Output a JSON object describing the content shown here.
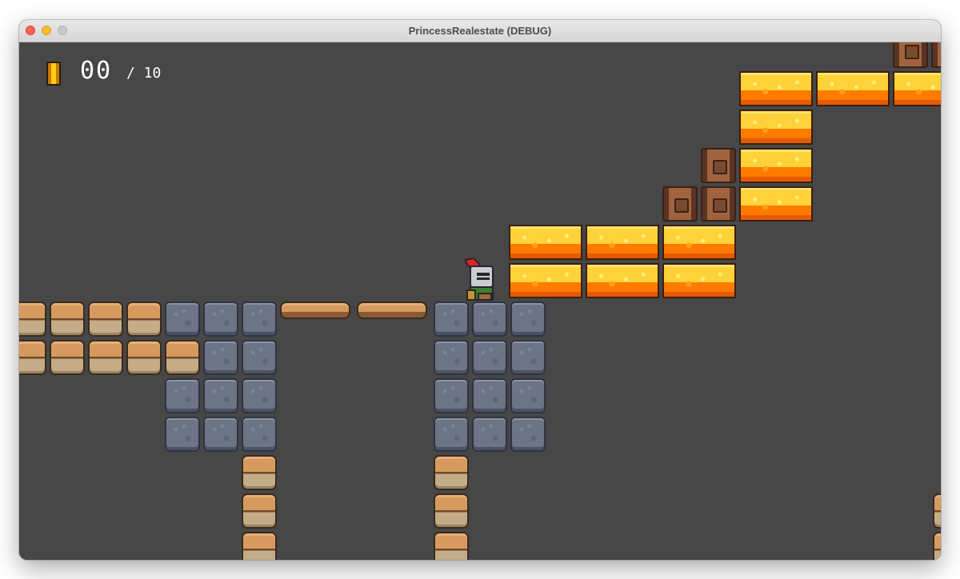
{
  "window": {
    "title": "PrincessRealestate (DEBUG)"
  },
  "hud": {
    "coins_collected": "00",
    "coins_total": "/ 10",
    "coin_icon": "coin-icon"
  },
  "scene": {
    "player": "knight",
    "tile_types": [
      "stone-block",
      "sand-block",
      "sand-bridge",
      "lava-block",
      "wooden-crate"
    ]
  }
}
